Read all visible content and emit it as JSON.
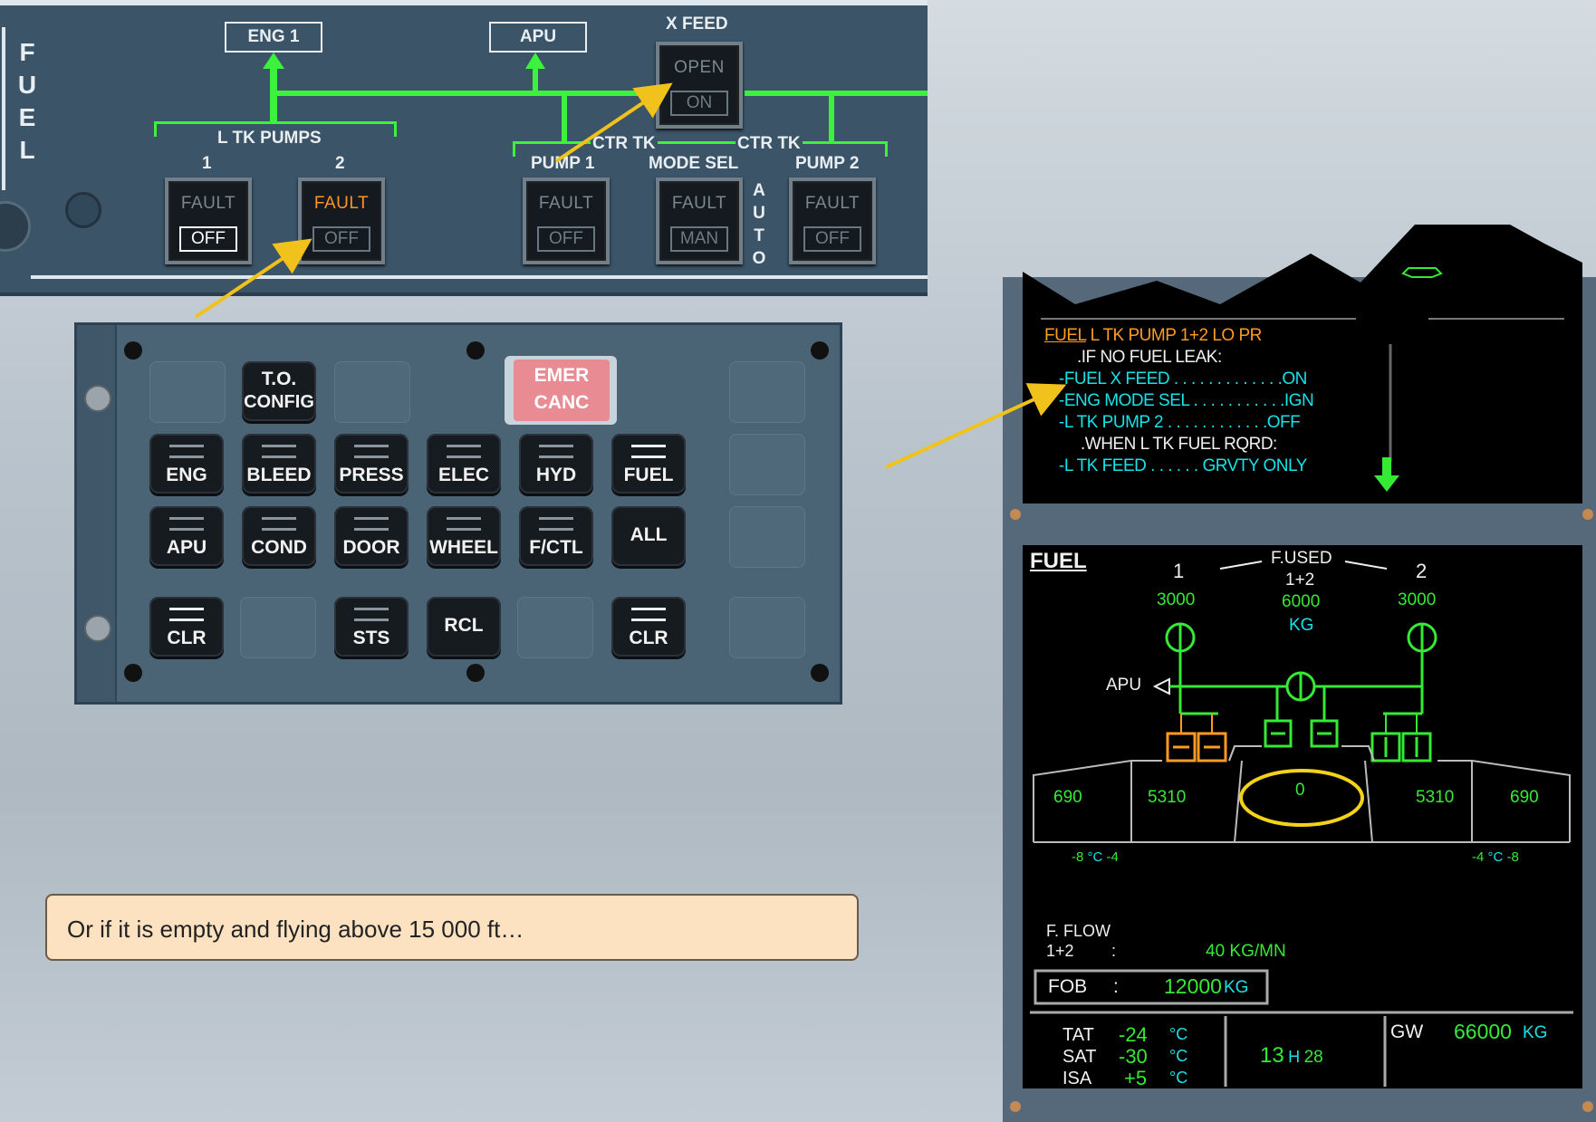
{
  "fuel_panel": {
    "side_title": [
      "F",
      "U",
      "E",
      "L"
    ],
    "eng1_label": "ENG 1",
    "apu_label": "APU",
    "xfeed_label": "X FEED",
    "xfeed_button": {
      "fault": "OPEN",
      "state": "ON"
    },
    "l_tk_pumps_label": "L TK PUMPS",
    "pump1_num": "1",
    "pump2_num": "2",
    "ctr_tk_pump1_line1": "CTR TK",
    "ctr_tk_pump1_line2": "PUMP 1",
    "mode_sel_label": "MODE SEL",
    "ctr_tk_pump2_line1": "CTR TK",
    "ctr_tk_pump2_line2": "PUMP 2",
    "auto_letters": [
      "A",
      "U",
      "T",
      "O"
    ],
    "buttons": [
      {
        "fault": "FAULT",
        "state": "OFF"
      },
      {
        "fault": "FAULT",
        "state": "OFF"
      },
      {
        "fault": "FAULT",
        "state": "OFF"
      },
      {
        "fault": "FAULT",
        "state": "MAN"
      },
      {
        "fault": "FAULT",
        "state": "OFF"
      }
    ]
  },
  "ecam_control_panel": {
    "to_config": [
      "T.O.",
      "CONFIG"
    ],
    "emer_canc": [
      "EMER",
      "CANC"
    ],
    "row1": [
      "ENG",
      "BLEED",
      "PRESS",
      "ELEC",
      "HYD",
      "FUEL"
    ],
    "row2": [
      "APU",
      "COND",
      "DOOR",
      "WHEEL",
      "F/CTL",
      "ALL"
    ],
    "clr_left": "CLR",
    "sts": "STS",
    "rcl": "RCL",
    "clr_right": "CLR"
  },
  "ewd": {
    "warning_title_fuel": "FUEL",
    "warning_title_rest": " L TK PUMP 1+2 LO PR",
    "line_if": ".IF NO FUEL LEAK:",
    "line_xfeed": "-FUEL X FEED . . . . . . . . . . . . .ON",
    "line_mode": "-ENG MODE SEL . . . . . . . . . . .IGN",
    "line_pump": "-L TK PUMP 2 . . . . . . . . . . . .OFF",
    "line_when": ".WHEN L TK FUEL RQRD:",
    "line_feed": "-L TK FEED . . . . . . GRVTY ONLY"
  },
  "sd": {
    "title": "FUEL",
    "f_used": "F.USED",
    "f_used_sub": "1+2",
    "eng1_num": "1",
    "eng2_num": "2",
    "eng1_used": "3000",
    "total_used": "6000",
    "eng2_used": "3000",
    "unit_kg": "KG",
    "apu": "APU",
    "left_outer": "690",
    "left_inner": "5310",
    "center": "0",
    "right_inner": "5310",
    "right_outer": "690",
    "left_temp_a": "-8",
    "left_temp_unit": "°C",
    "left_temp_b": "-4",
    "right_temp_a": "-4",
    "right_temp_unit": "°C",
    "right_temp_b": "-8",
    "fflow_label": "F. FLOW",
    "fflow_sub": "1+2",
    "fflow_colon": ":",
    "fflow_value": "40 KG/MN",
    "fob_label": "FOB",
    "fob_colon": ":",
    "fob_value": "12000",
    "fob_unit": "KG",
    "tat_label": "TAT",
    "tat_value": "-24",
    "sat_label": "SAT",
    "sat_value": "-30",
    "isa_label": "ISA",
    "isa_value": "+5",
    "deg_c": "°C",
    "time_h": "13",
    "time_h_label": "H",
    "time_m": "28",
    "gw_label": "GW",
    "gw_value": "66000",
    "gw_unit": "KG"
  },
  "caption": "Or if it is empty and flying above 15 000 ft…",
  "colors": {
    "green": "#35ea35",
    "amber": "#ff9a22",
    "cyan": "#16e3e8",
    "panel": "#3b5468"
  }
}
